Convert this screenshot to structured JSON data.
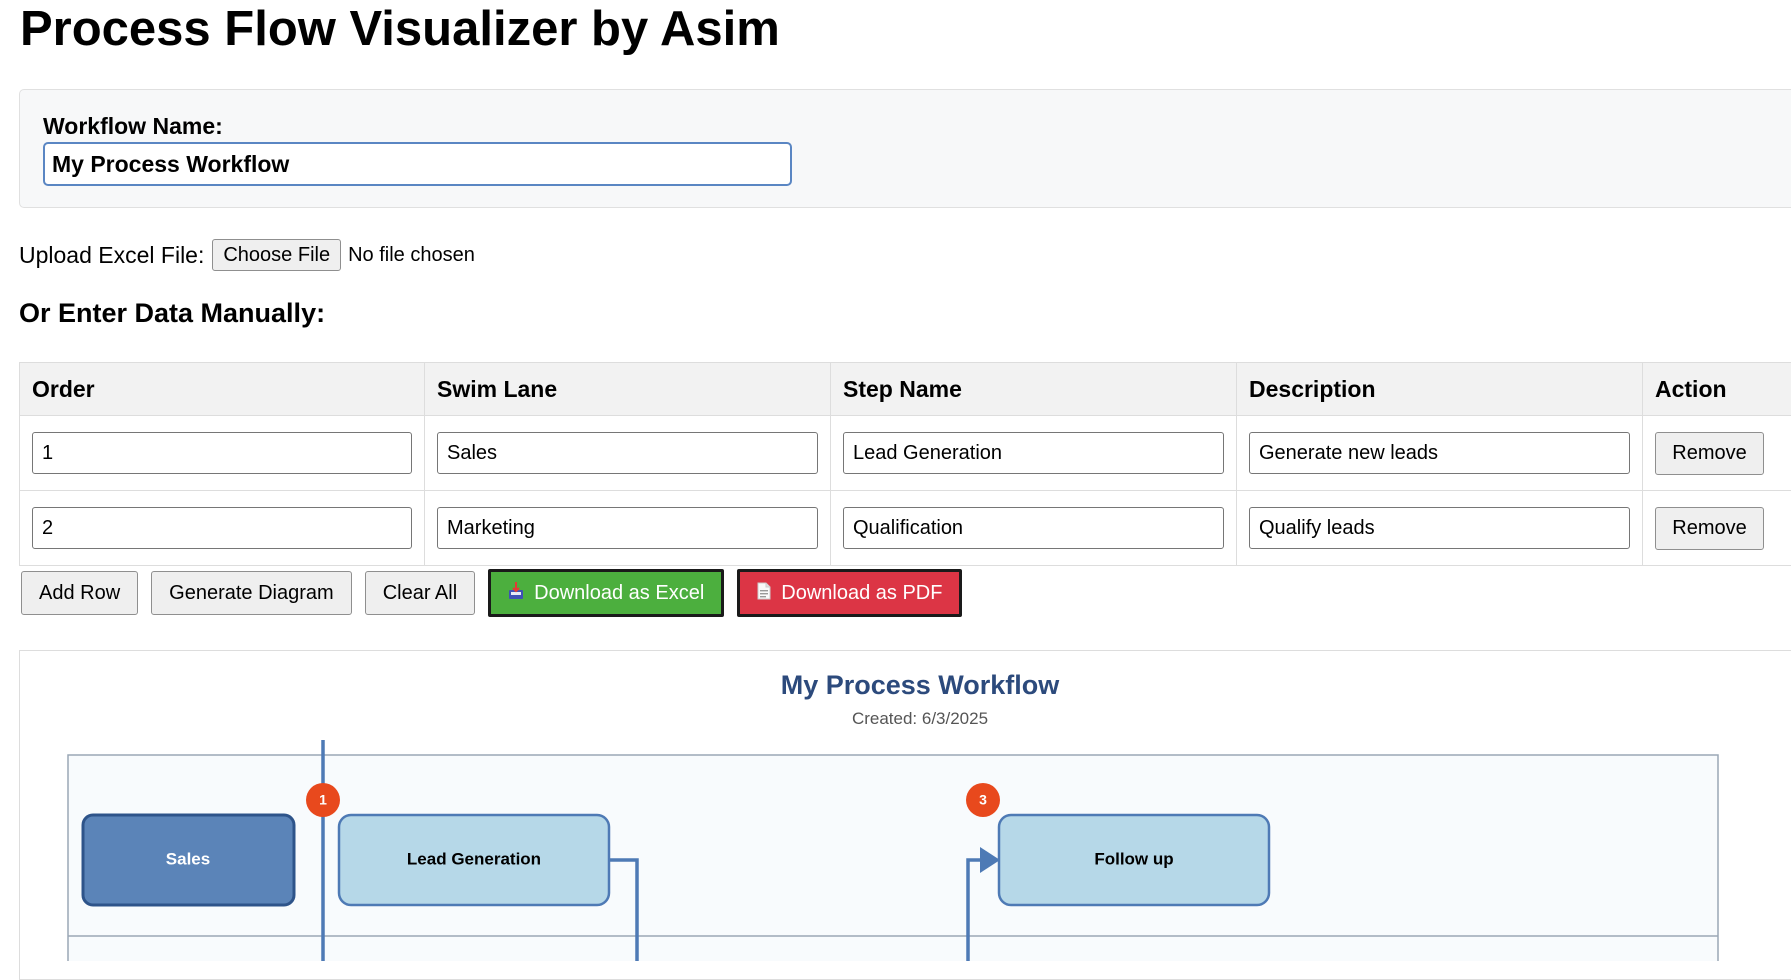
{
  "page": {
    "title": "Process Flow Visualizer by Asim"
  },
  "workflow": {
    "label": "Workflow Name:",
    "value": "My Process Workflow"
  },
  "upload": {
    "label": "Upload Excel File:",
    "button_label": "Choose File",
    "status": "No file chosen"
  },
  "manual": {
    "heading": "Or Enter Data Manually:"
  },
  "table": {
    "headers": [
      "Order",
      "Swim Lane",
      "Step Name",
      "Description",
      "Action"
    ],
    "rows": [
      {
        "order": "1",
        "swim_lane": "Sales",
        "step_name": "Lead Generation",
        "description": "Generate new leads",
        "action": "Remove"
      },
      {
        "order": "2",
        "swim_lane": "Marketing",
        "step_name": "Qualification",
        "description": "Qualify leads",
        "action": "Remove"
      }
    ]
  },
  "actions": {
    "add_row": "Add Row",
    "generate": "Generate Diagram",
    "clear": "Clear All",
    "download_excel": "Download as Excel",
    "download_pdf": "Download as PDF"
  },
  "diagram": {
    "title": "My Process Workflow",
    "created": "Created: 6/3/2025",
    "lane_label": "Sales",
    "steps": [
      {
        "badge": "1",
        "label": "Lead Generation"
      },
      {
        "badge": "3",
        "label": "Follow up"
      }
    ]
  },
  "colors": {
    "excel_button": "#4caf3e",
    "pdf_button": "#dc3545",
    "lane_box": "#5b84b8",
    "step_box": "#b6d8e8",
    "badge": "#e8491d",
    "connector": "#4e7ab5",
    "diagram_title": "#2c4a7c"
  },
  "icons": {
    "excel": "inbox-tray-icon",
    "pdf": "page-icon"
  }
}
